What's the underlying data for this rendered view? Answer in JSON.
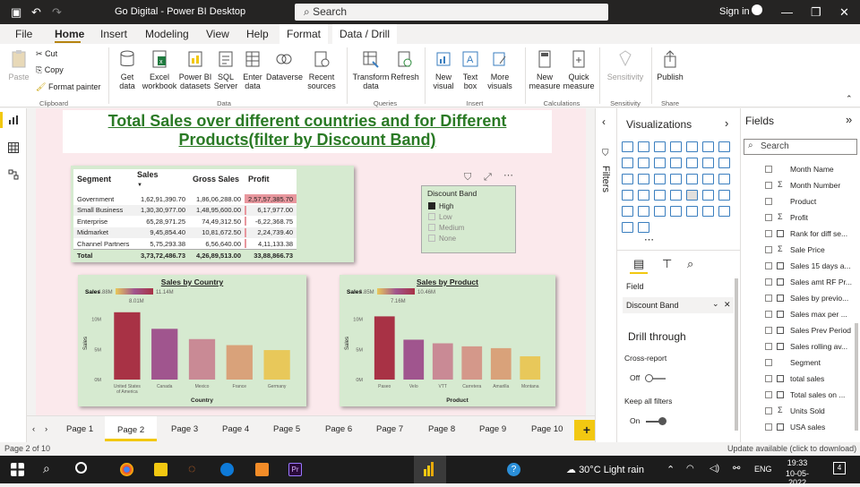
{
  "app": {
    "title": "Go Digital - Power BI Desktop",
    "search_placeholder": "Search",
    "signin": "Sign in"
  },
  "ribbon_tabs": [
    "File",
    "Home",
    "Insert",
    "Modeling",
    "View",
    "Help",
    "Format",
    "Data / Drill"
  ],
  "ribbon": {
    "clipboard": {
      "paste": "Paste",
      "cut": "Cut",
      "copy": "Copy",
      "format_painter": "Format painter",
      "group": "Clipboard"
    },
    "data": {
      "get_data": "Get data",
      "excel": "Excel workbook",
      "pbi": "Power BI datasets",
      "sql": "SQL Server",
      "enter": "Enter data",
      "dataverse": "Dataverse",
      "recent": "Recent sources",
      "group": "Data"
    },
    "queries": {
      "transform": "Transform data",
      "refresh": "Refresh",
      "group": "Queries"
    },
    "insert": {
      "new_visual": "New visual",
      "text_box": "Text box",
      "more_visuals": "More visuals",
      "group": "Insert"
    },
    "calculations": {
      "new_measure": "New measure",
      "quick_measure": "Quick measure",
      "group": "Calculations"
    },
    "sensitivity": {
      "label": "Sensitivity",
      "group": "Sensitivity"
    },
    "share": {
      "publish": "Publish",
      "group": "Share"
    }
  },
  "report": {
    "title_line1": "Total Sales over different countries and for Different ",
    "title_line2": "Products(filter by Discount Band)"
  },
  "table": {
    "headers": [
      "Segment",
      "Sales",
      "Gross Sales",
      "Profit"
    ],
    "rows": [
      {
        "segment": "Government",
        "sales": "1,62,91,390.70",
        "gross": "1,86,06,288.00",
        "profit": "2,57,57,385.70",
        "profit_ratio": 1.0
      },
      {
        "segment": "Small Business",
        "sales": "1,30,30,977.00",
        "gross": "1,48,95,600.00",
        "profit": "6,17,977.00",
        "profit_ratio": 0.03
      },
      {
        "segment": "Enterprise",
        "sales": "65,28,971.25",
        "gross": "74,49,312.50",
        "profit": "-6,22,368.75",
        "profit_ratio": 0.0
      },
      {
        "segment": "Midmarket",
        "sales": "9,45,854.40",
        "gross": "10,81,672.50",
        "profit": "2,24,739.40",
        "profit_ratio": 0.01
      },
      {
        "segment": "Channel Partners",
        "sales": "5,75,293.38",
        "gross": "6,56,640.00",
        "profit": "4,11,133.38",
        "profit_ratio": 0.02
      }
    ],
    "total": {
      "label": "Total",
      "sales": "3,73,72,486.73",
      "gross": "4,26,89,513.00",
      "profit": "33,88,866.73"
    }
  },
  "slicer": {
    "title": "Discount Band",
    "options": [
      "High",
      "Low",
      "Medium",
      "None"
    ],
    "selected": "High"
  },
  "chart_data": [
    {
      "type": "bar",
      "title": "Sales by Country",
      "xlabel": "Country",
      "ylabel": "Sales",
      "legend_label": "Sales",
      "legend_min": "4.88M",
      "legend_mid": "8.01M",
      "legend_max": "11.14M",
      "categories": [
        "United States of America",
        "Canada",
        "Mexico",
        "France",
        "Germany"
      ],
      "values": [
        11.14,
        8.4,
        6.7,
        5.7,
        4.88
      ],
      "yticks": [
        "10M",
        "5M",
        "0M"
      ],
      "ylim": [
        0,
        12
      ],
      "colors": [
        "#a83245",
        "#a0558e",
        "#c98a95",
        "#d9a27a",
        "#e8c85a"
      ]
    },
    {
      "type": "bar",
      "title": "Sales by Product",
      "xlabel": "Product",
      "ylabel": "Sales",
      "legend_label": "Sales",
      "legend_min": "3.85M",
      "legend_mid": "7.16M",
      "legend_max": "10.46M",
      "categories": [
        "Paseo",
        "Velo",
        "VTT",
        "Carretera",
        "Amarilla",
        "Montana"
      ],
      "values": [
        10.46,
        6.6,
        6.0,
        5.5,
        5.2,
        3.85
      ],
      "yticks": [
        "10M",
        "5M",
        "0M"
      ],
      "ylim": [
        0,
        12
      ],
      "colors": [
        "#a83245",
        "#a0558e",
        "#c98a95",
        "#d4988a",
        "#d9a27a",
        "#e8c85a"
      ]
    }
  ],
  "pages": [
    "Page 1",
    "Page 2",
    "Page 3",
    "Page 4",
    "Page 5",
    "Page 6",
    "Page 7",
    "Page 8",
    "Page 9",
    "Page 10"
  ],
  "active_page": "Page 2",
  "filters_label": "Filters",
  "viz_pane": {
    "title": "Visualizations",
    "field_tab": "Field",
    "field_value": "Discount Band",
    "drill_through": "Drill through",
    "cross_report": "Cross-report",
    "cross_state": "Off",
    "keep_filters": "Keep all filters",
    "keep_state": "On"
  },
  "fields_pane": {
    "title": "Fields",
    "search_placeholder": "Search",
    "items": [
      {
        "label": "Month Name",
        "kind": "plain"
      },
      {
        "label": "Month Number",
        "kind": "sigma"
      },
      {
        "label": "Product",
        "kind": "plain"
      },
      {
        "label": "Profit",
        "kind": "sigma"
      },
      {
        "label": "Rank for diff se...",
        "kind": "calc"
      },
      {
        "label": "Sale Price",
        "kind": "sigma"
      },
      {
        "label": "Sales 15 days a...",
        "kind": "calc"
      },
      {
        "label": "Sales amt RF Pr...",
        "kind": "calc"
      },
      {
        "label": "Sales by previo...",
        "kind": "calc"
      },
      {
        "label": "Sales max per ...",
        "kind": "calc"
      },
      {
        "label": "Sales Prev Period",
        "kind": "calc"
      },
      {
        "label": "Sales rolling av...",
        "kind": "calc"
      },
      {
        "label": "Segment",
        "kind": "plain"
      },
      {
        "label": "total sales",
        "kind": "calc"
      },
      {
        "label": "Total sales on ...",
        "kind": "calc"
      },
      {
        "label": "Units Sold",
        "kind": "sigma"
      },
      {
        "label": "USA sales",
        "kind": "calc"
      }
    ]
  },
  "status": {
    "page": "Page 2 of 10",
    "update": "Update available (click to download)"
  },
  "taskbar": {
    "weather": "30°C  Light rain",
    "lang": "ENG",
    "time": "19:33",
    "date": "10-05-2022",
    "notif": "4"
  }
}
